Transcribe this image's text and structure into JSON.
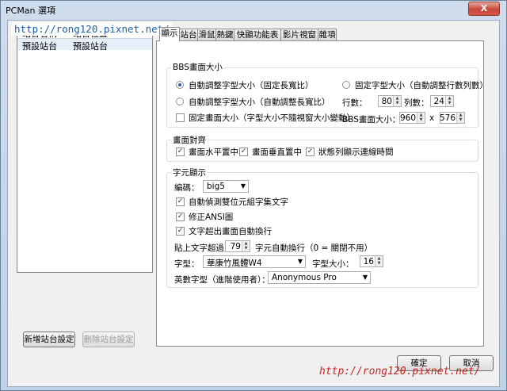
{
  "window": {
    "title": "PCMan 選項",
    "close_glyph": "X"
  },
  "watermark": {
    "top": "http://rong120.pixnet.net/",
    "bottom": "http://rong120.pixnet.net/"
  },
  "site_list": {
    "headers": [
      "站台名稱",
      "站台位置"
    ],
    "rows": [
      {
        "name": "預設站台",
        "location": "預設站台"
      }
    ]
  },
  "buttons": {
    "add_site": "新增站台設定",
    "remove_site": "刪除站台設定",
    "ok": "確定",
    "cancel": "取消"
  },
  "tabs": [
    "顯示",
    "站台",
    "滑鼠",
    "熱鍵",
    "快顯功能表",
    "影片視窗",
    "雜項"
  ],
  "bbs_size": {
    "group_label": "BBS畫面大小",
    "opt_auto_fixed": "自動調整字型大小（固定長寬比）",
    "opt_auto_free": "自動調整字型大小（自動調整長寬比）",
    "opt_fixed_font": "固定字型大小（自動調整行數列數）",
    "chk_fixed_screen": "固定畫面大小（字型大小不隨視窗大小變動）",
    "rows_label": "行數：",
    "rows_value": "80",
    "cols_label": "列數：",
    "cols_value": "24",
    "bbs_label": "BBS畫面大小：",
    "width": "960",
    "times": "x",
    "height": "576"
  },
  "align": {
    "group_label": "畫面對齊",
    "h_center": "畫面水平置中",
    "v_center": "畫面垂直置中",
    "status_time": "狀態列顯示連線時間"
  },
  "chars": {
    "group_label": "字元顯示",
    "encoding_label": "編碼：",
    "encoding_value": "big5",
    "detect_dbcs": "自動偵測雙位元組字集文字",
    "fix_ansi": "修正ANSI圖",
    "wrap": "文字超出畫面自動換行",
    "paste_prefix": "貼上文字超過",
    "paste_value": "79",
    "paste_suffix": "字元自動換行（0 = 關閉不用）",
    "font_label": "字型：",
    "font_value": "華康竹風體W4",
    "font_size_label": "字型大小：",
    "font_size_value": "16",
    "en_font_label": "英數字型（進階使用者）：",
    "en_font_value": "Anonymous Pro"
  }
}
